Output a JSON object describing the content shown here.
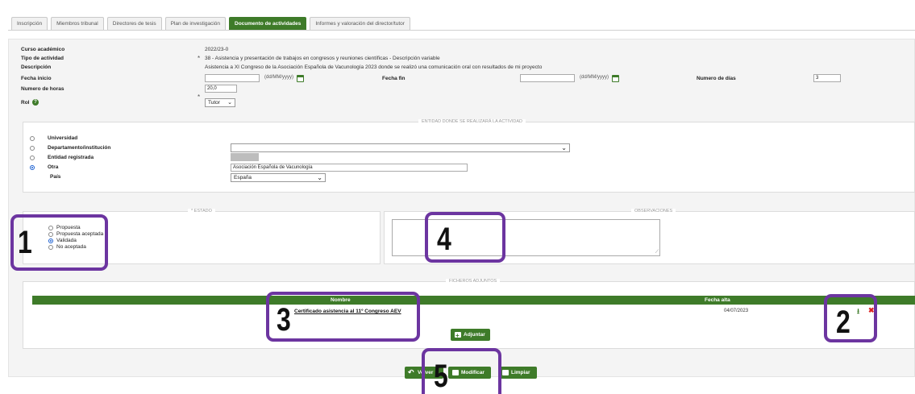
{
  "tabs": [
    {
      "label": "Inscripción",
      "active": false
    },
    {
      "label": "Miembros tribunal",
      "active": false
    },
    {
      "label": "Directores de tesis",
      "active": false
    },
    {
      "label": "Plan de investigación",
      "active": false
    },
    {
      "label": "Documento de actividades",
      "active": true
    },
    {
      "label": "Informes y valoración del director/tutor",
      "active": false
    }
  ],
  "form": {
    "curso_label": "Curso académico",
    "curso_value": "2022/23-0",
    "tipo_label": "Tipo de actividad",
    "tipo_value": "38 - Asistencia y presentación de trabajos en congresos y reuniones científicas - Descripción variable",
    "desc_label": "Descripción",
    "desc_value": "Asistencia a XI Congreso de la Asociación Española de Vacunología 2023 donde se realizó una comunicación oral con resultados de mi proyecto",
    "inicio_label": "Fecha inicio",
    "inicio_value": "",
    "date_hint": "(dd/MM/yyyy)",
    "fin_label": "Fecha fin",
    "fin_value": "",
    "dias_label": "Numero de días",
    "dias_value": "3",
    "horas_label": "Numero de horas",
    "horas_value": "20,0",
    "rol_label": "Rol",
    "rol_value": "Tutor",
    "required_mark": "*"
  },
  "entidad": {
    "legend": "ENTIDAD DONDE SE REALIZARÁ LA ACTIVIDAD",
    "options": [
      {
        "label": "Universidad",
        "selected": false
      },
      {
        "label": "Departamento/institución",
        "selected": false
      },
      {
        "label": "Entidad registrada",
        "selected": false
      },
      {
        "label": "Otra",
        "selected": true
      }
    ],
    "pais_label": "País",
    "otra_value": "Asociación Española de Vacunología",
    "pais_value": "España"
  },
  "estado": {
    "legend": "* ESTADO",
    "options": [
      {
        "label": "Propuesta",
        "selected": false
      },
      {
        "label": "Propuesta aceptada",
        "selected": false
      },
      {
        "label": "Validada",
        "selected": true
      },
      {
        "label": "No aceptada",
        "selected": false
      }
    ]
  },
  "observaciones": {
    "legend": "OBSERVACIONES",
    "value": ""
  },
  "ficheros": {
    "legend": "FICHEROS ADJUNTOS",
    "col_nombre": "Nombre",
    "col_fecha": "Fecha alta",
    "rows": [
      {
        "nombre": "Certificado asistencia al 11º Congreso AEV",
        "fecha": "04/07/2023"
      }
    ],
    "adjuntar_label": "Adjuntar"
  },
  "actions": {
    "volver_label": "Volver",
    "modificar_label": "Modificar",
    "limpiar_label": "Limpiar"
  },
  "callouts": [
    "1",
    "2",
    "3",
    "4",
    "5"
  ],
  "colors": {
    "accent_green": "#3e7b29",
    "callout_purple": "#6c35a0",
    "delete_red": "#dd2222"
  }
}
